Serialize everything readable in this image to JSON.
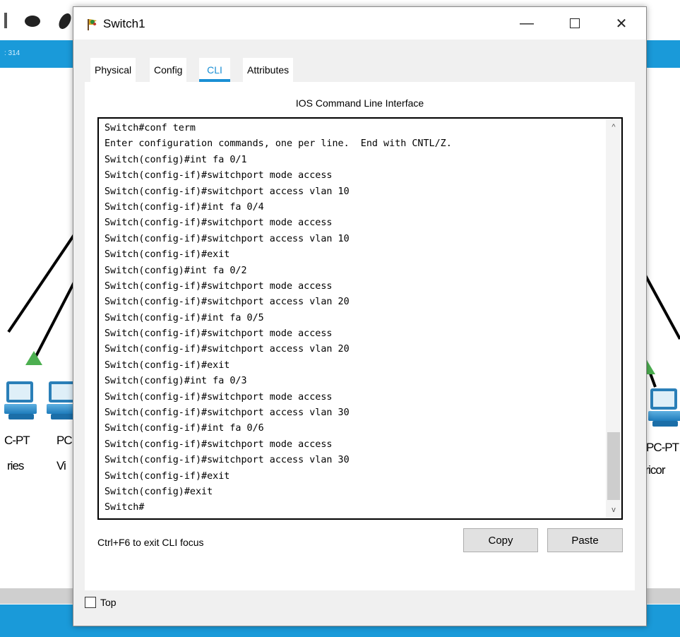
{
  "window": {
    "title": "Switch1",
    "minimize_glyph": "—",
    "close_glyph": "✕"
  },
  "tabs": [
    {
      "label": "Physical"
    },
    {
      "label": "Config"
    },
    {
      "label": "CLI",
      "active": true
    },
    {
      "label": "Attributes"
    }
  ],
  "cli_panel": {
    "heading": "IOS Command Line Interface",
    "lines": [
      "Switch#conf term",
      "Enter configuration commands, one per line.  End with CNTL/Z.",
      "Switch(config)#int fa 0/1",
      "Switch(config-if)#switchport mode access",
      "Switch(config-if)#switchport access vlan 10",
      "Switch(config-if)#int fa 0/4",
      "Switch(config-if)#switchport mode access",
      "Switch(config-if)#switchport access vlan 10",
      "Switch(config-if)#exit",
      "Switch(config)#int fa 0/2",
      "Switch(config-if)#switchport mode access",
      "Switch(config-if)#switchport access vlan 20",
      "Switch(config-if)#int fa 0/5",
      "Switch(config-if)#switchport mode access",
      "Switch(config-if)#switchport access vlan 20",
      "Switch(config-if)#exit",
      "Switch(config)#int fa 0/3",
      "Switch(config-if)#switchport mode access",
      "Switch(config-if)#switchport access vlan 30",
      "Switch(config-if)#int fa 0/6",
      "Switch(config-if)#switchport mode access",
      "Switch(config-if)#switchport access vlan 30",
      "Switch(config-if)#exit",
      "Switch(config)#exit",
      "Switch#"
    ],
    "scroll_up_glyph": "^",
    "scroll_down_glyph": "v",
    "hint": "Ctrl+F6 to exit CLI focus",
    "copy_label": "Copy",
    "paste_label": "Paste"
  },
  "footer": {
    "top_label": "Top",
    "top_checked": false
  },
  "background": {
    "band_label": ": 314",
    "devices": [
      {
        "label_line1": "C-PT",
        "label_line2": "ries"
      },
      {
        "label_line1": "PC",
        "label_line2": "Vi"
      },
      {
        "label_line1": "PC-PT",
        "label_line2": "pricor"
      }
    ]
  },
  "colors": {
    "accent": "#1a8fd4",
    "workspace_band": "#1a9ad9",
    "link_green": "#4caf50"
  }
}
